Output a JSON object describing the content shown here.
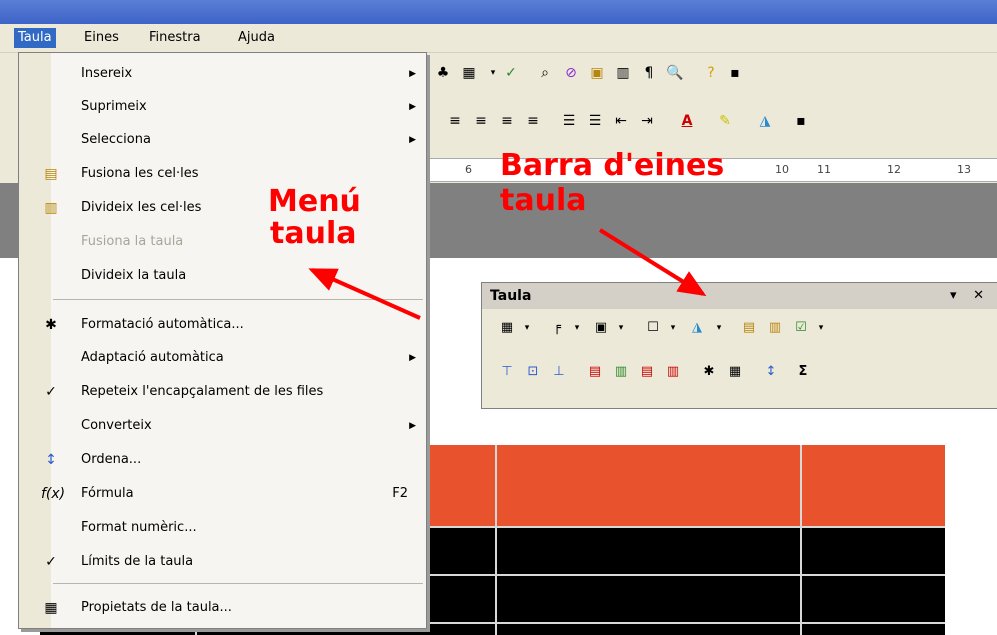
{
  "menubar": {
    "items": [
      {
        "label": "Taula",
        "active": true
      },
      {
        "label": "Eines"
      },
      {
        "label": "Finestra"
      },
      {
        "label": "Ajuda"
      }
    ]
  },
  "menu": {
    "items": [
      {
        "label": "Insereix",
        "submenu": true
      },
      {
        "label": "Suprimeix",
        "submenu": true
      },
      {
        "label": "Selecciona",
        "submenu": true
      },
      {
        "label": "Fusiona les cel·les",
        "icon": "merge-cells-icon"
      },
      {
        "label": "Divideix les cel·les",
        "icon": "split-cells-icon"
      },
      {
        "label": "Fusiona la taula",
        "disabled": true
      },
      {
        "label": "Divideix la taula"
      },
      {
        "label": "Formatació automàtica...",
        "icon": "autoformat-icon"
      },
      {
        "label": "Adaptació automàtica",
        "submenu": true
      },
      {
        "label": "Repeteix l'encapçalament de les files",
        "checked": true
      },
      {
        "label": "Converteix",
        "submenu": true
      },
      {
        "label": "Ordena...",
        "icon": "sort-icon"
      },
      {
        "label": "Fórmula",
        "icon": "formula-icon",
        "shortcut": "F2"
      },
      {
        "label": "Format numèric..."
      },
      {
        "label": "Límits de la taula",
        "checked": true
      },
      {
        "label": "Propietats de la taula...",
        "icon": "table-properties-icon"
      }
    ]
  },
  "ruler": {
    "marks": [
      "6",
      "8",
      "10",
      "11",
      "12",
      "13"
    ]
  },
  "floating_toolbar": {
    "title": "Taula",
    "controls": "▾ ✕"
  },
  "annotations": {
    "menu_label_1": "Menú",
    "menu_label_2": "taula",
    "toolbar_label_1": "Barra d'eines",
    "toolbar_label_2": "taula"
  },
  "colors": {
    "accent": "#316ac5",
    "table_header": "#e8532e",
    "annotation": "#ff0000"
  }
}
